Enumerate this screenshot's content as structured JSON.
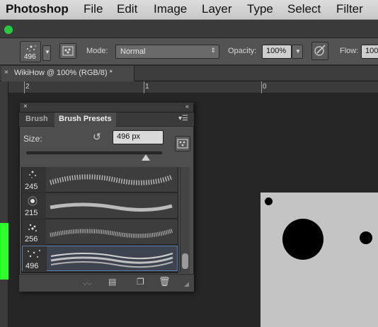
{
  "menubar": {
    "items": [
      "Photoshop",
      "File",
      "Edit",
      "Image",
      "Layer",
      "Type",
      "Select",
      "Filter"
    ]
  },
  "options_bar": {
    "brush_size_preview": "496",
    "mode_label": "Mode:",
    "mode_value": "Normal",
    "opacity_label": "Opacity:",
    "opacity_value": "100%",
    "flow_label": "Flow:",
    "flow_value": "100"
  },
  "document": {
    "tab_title": "WikiHow @ 100% (RGB/8) *",
    "ruler_labels": [
      "2",
      "1",
      "0"
    ]
  },
  "brush_panel": {
    "tabs": [
      "Brush",
      "Brush Presets"
    ],
    "active_tab": "Brush Presets",
    "size_label": "Size:",
    "size_value": "496 px",
    "size_slider_fraction": 0.88,
    "presets": [
      {
        "size": "245"
      },
      {
        "size": "215"
      },
      {
        "size": "256"
      },
      {
        "size": "496",
        "selected": true
      }
    ]
  },
  "colors": {
    "accent_green": "#2cff2c",
    "traffic_light_green": "#27c93f",
    "canvas_gray": "#c4c4c4"
  }
}
